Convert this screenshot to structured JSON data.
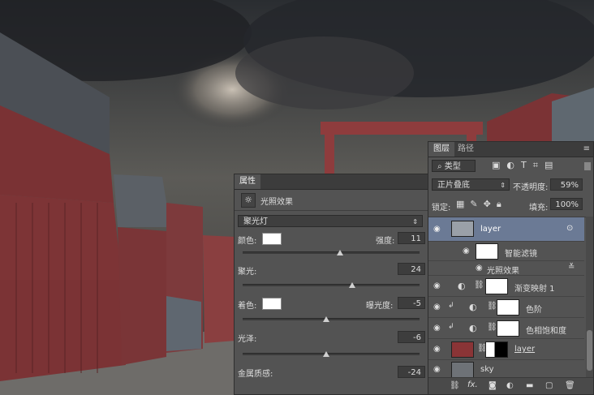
{
  "properties_panel": {
    "tab_label": "属性",
    "effect_title": "光照效果",
    "light_type": "聚光灯",
    "color_label": "颜色:",
    "intensity_label": "强度:",
    "intensity_value": "11",
    "hotspot_label": "聚光:",
    "hotspot_value": "24",
    "colorize_label": "着色:",
    "exposure_label": "曝光度:",
    "exposure_value": "-5",
    "gloss_label": "光泽:",
    "gloss_value": "-6",
    "metallic_label": "金属质感:",
    "metallic_value": "-24",
    "sliders": {
      "intensity": 0.62,
      "hotspot": 0.62,
      "exposure": 0.47,
      "gloss": 0.47
    }
  },
  "layers_panel": {
    "tabs": [
      "图层",
      "路径"
    ],
    "filter_kind": "类型",
    "blend_mode": "正片叠底",
    "opacity_label": "不透明度:",
    "opacity_value": "59%",
    "lock_label": "锁定:",
    "fill_label": "填充:",
    "fill_value": "100%",
    "layers": [
      {
        "name": "layer",
        "selected": true
      },
      {
        "name": "智能滤镜"
      },
      {
        "name": "光照效果"
      },
      {
        "name": "渐变映射 1"
      },
      {
        "name": "色阶"
      },
      {
        "name": "色相饱和度"
      },
      {
        "name": "layer"
      },
      {
        "name": "sky"
      }
    ],
    "bottom_fx": "fx."
  },
  "colors": {
    "panel_bg": "#535353",
    "selected_row": "#6b7a95",
    "header": "#3c3c3c"
  }
}
